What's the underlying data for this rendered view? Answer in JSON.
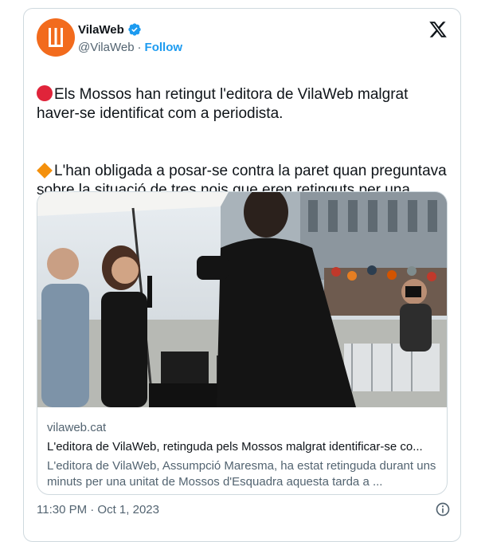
{
  "author": {
    "display_name": "VilaWeb",
    "handle": "@VilaWeb",
    "follow_label": "Follow",
    "separator": "·",
    "avatar_color": "#f26b1d",
    "verified_color": "#1d9bf0"
  },
  "tweet": {
    "paragraph1": "Els Mossos han retingut l'editora de VilaWeb malgrat haver-se identificat com a periodista.",
    "paragraph2": "L'han obligada a posar-se contra la paret quan preguntava sobre la situació de tres nois que eren retinguts per una patrulla",
    "emoji1": "red-circle-icon",
    "emoji2": "orange-diamond-icon"
  },
  "link_card": {
    "domain": "vilaweb.cat",
    "title": "L'editora de VilaWeb, retinguda pels Mossos malgrat identificar-se co...",
    "description": "L'editora de VilaWeb, Assumpció Maresma, ha estat retinguda durant uns minuts per una unitat de Mossos d'Esquadra aquesta tarda a ..."
  },
  "footer": {
    "timestamp": "11:30 PM · Oct 1, 2023",
    "info_icon": "info-icon"
  }
}
